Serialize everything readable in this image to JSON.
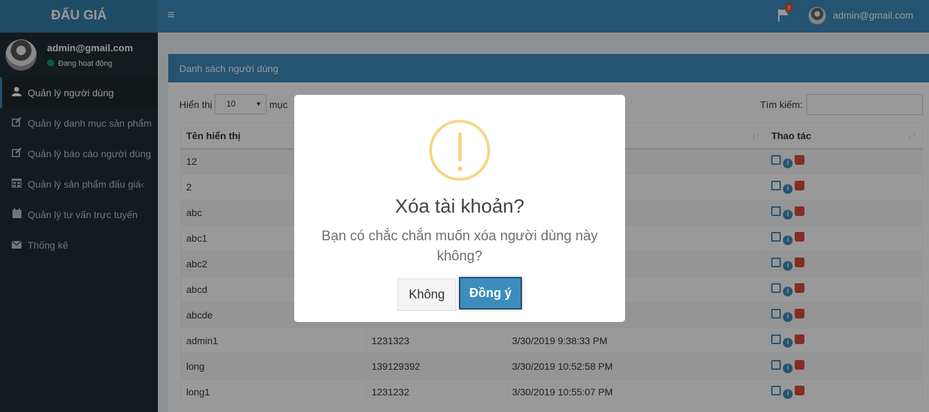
{
  "app": {
    "logo": "ĐẤU GIÁ"
  },
  "header": {
    "notifications_count": "9",
    "user_email": "admin@gmail.com"
  },
  "sidebar": {
    "user_email": "admin@gmail.com",
    "status": "Đang hoạt động",
    "items": [
      {
        "label": "Quản lý người dùng",
        "icon": "user-icon",
        "active": true
      },
      {
        "label": "Quản lý danh mục sản phẩm",
        "icon": "edit-icon"
      },
      {
        "label": "Quản lý báo cáo người dùng",
        "icon": "edit-icon"
      },
      {
        "label": "Quản lý sản phẩm đấu giá",
        "icon": "table-icon"
      },
      {
        "label": "Quản lý tư vấn trực tuyến",
        "icon": "calendar-icon"
      },
      {
        "label": "Thống kê",
        "icon": "envelope-icon"
      }
    ]
  },
  "box": {
    "title": "Danh sách người dùng",
    "length_label": "Hiển thị",
    "length_value": "10",
    "length_suffix": "mục",
    "search_label": "Tìm kiếm:",
    "columns": [
      "Tên hiển thị",
      "",
      "",
      "Thao tác"
    ],
    "rows": [
      [
        "12",
        "",
        ""
      ],
      [
        "2",
        "",
        ""
      ],
      [
        "abc",
        "",
        ""
      ],
      [
        "abc1",
        "",
        ""
      ],
      [
        "abc2",
        "",
        ""
      ],
      [
        "abcd",
        "",
        ""
      ],
      [
        "abcde",
        "",
        ""
      ],
      [
        "admin1",
        "1231323",
        "3/30/2019 9:38:33 PM"
      ],
      [
        "long",
        "139129392",
        "3/30/2019 10:52:58 PM"
      ],
      [
        "long1",
        "1231232",
        "3/30/2019 10:55:07 PM"
      ]
    ]
  },
  "modal": {
    "title": "Xóa tài khoản?",
    "text": "Bạn có chắc chắn muốn xóa người dùng này không?",
    "cancel_label": "Không",
    "confirm_label": "Đồng ý"
  }
}
